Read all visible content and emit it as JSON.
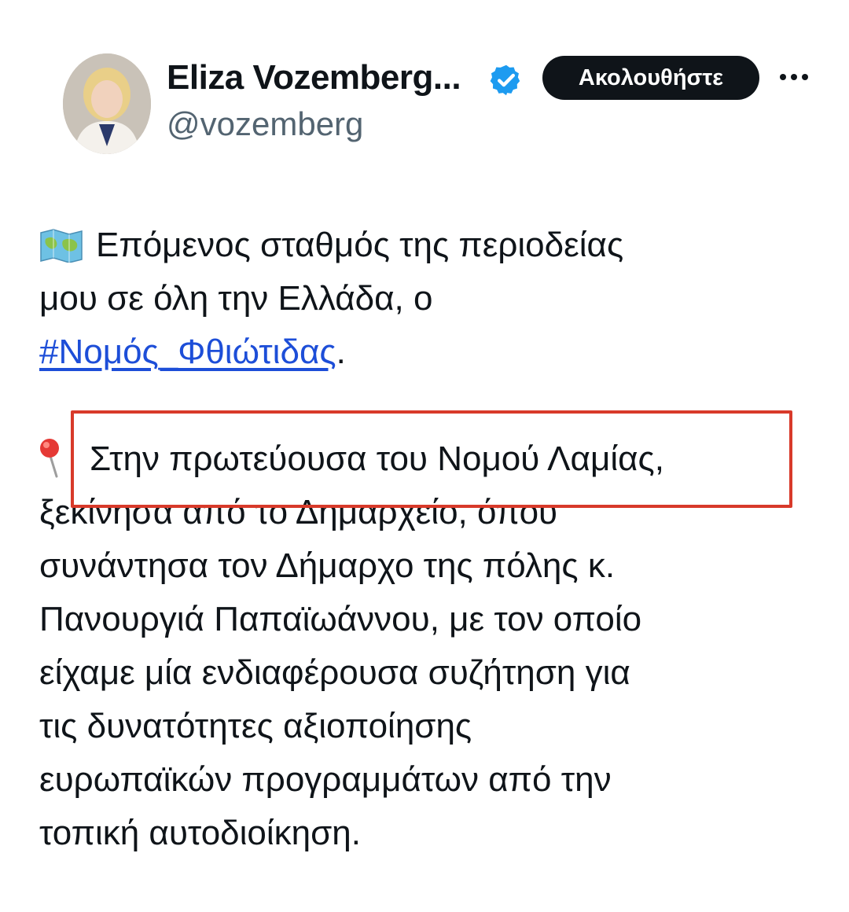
{
  "tweet": {
    "author_name": "Eliza Vozemberg...",
    "handle": "@vozemberg",
    "follow_label": "Ακολουθήστε",
    "lines": {
      "l1": "Επόμενος σταθμός της περιοδείας",
      "l2": "μου σε όλη την Ελλάδα, ο",
      "hashtag": "#Νομός_Φθιώτιδας",
      "hashtag_suffix": ".",
      "l4": "Στην πρωτεύουσα του Νομού Λαμίας,",
      "l5": "ξεκίνησα από το Δημαρχείο, όπου",
      "l6": "συνάντησα τον Δήμαρχο της πόλης κ.",
      "l7": "Πανουργιά Παπαϊωάννου, με τον οποίο",
      "l8": "είχαμε μία ενδιαφέρουσα συζήτηση για",
      "l9": "τις δυνατότητες αξιοποίησης",
      "l10": "ευρωπαϊκών προγραμμάτων από την",
      "l11": "τοπική αυτοδιοίκηση."
    }
  },
  "icons": {
    "verified": "verified-badge-icon",
    "more": "more-options-icon",
    "map": "world-map-emoji-icon",
    "pin": "round-pushpin-emoji-icon"
  },
  "colors": {
    "text": "#0f1419",
    "secondary": "#536471",
    "link": "#1d4ed8",
    "verified": "#1d9bf0",
    "highlight": "#d83a2a"
  }
}
